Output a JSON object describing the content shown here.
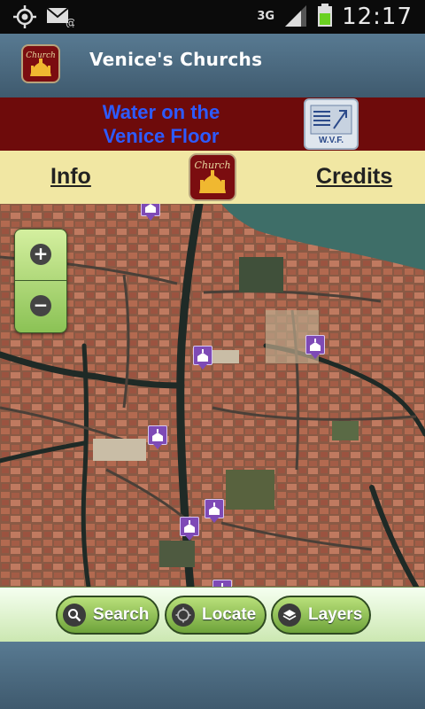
{
  "status_bar": {
    "time": "12:17",
    "network": "3G",
    "icons": [
      "gps-icon",
      "email-icon",
      "signal-icon",
      "battery-icon"
    ]
  },
  "header": {
    "title": "Venice's Churchs"
  },
  "banner": {
    "line1": "Water on the",
    "line2": "Venice Floor",
    "logo_text": "W.V.F."
  },
  "nav": {
    "info": "Info",
    "credits": "Credits"
  },
  "app_icon_text": "Church",
  "zoom": {
    "plus": "+",
    "minus": "−"
  },
  "toolbar": {
    "search": "Search",
    "locate": "Locate",
    "layers": "Layers"
  },
  "colors": {
    "banner_bg": "#6e0b0b",
    "banner_text": "#2d5bff",
    "nav_bg": "#f1e7a3",
    "header_bg": "#4a6a80",
    "marker": "#7e4ab6",
    "button_green": "#8bc255"
  }
}
